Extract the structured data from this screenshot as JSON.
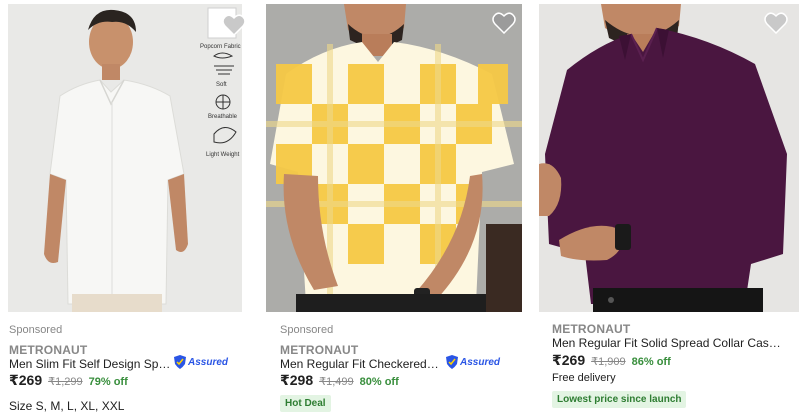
{
  "products": [
    {
      "sponsored": "Sponsored",
      "brand": "METRONAUT",
      "title": "Men Slim Fit Self Design Spre...",
      "assured": "Assured",
      "price": "₹269",
      "mrp": "₹1,299",
      "discount": "79% off",
      "sizes": "Size S, M, L, XL, XXL",
      "features": [
        "Popcorn Fabric",
        "Soft",
        "Breathable",
        "Light Weight"
      ],
      "shirt_color": "#f4f4f2"
    },
    {
      "sponsored": "Sponsored",
      "brand": "METRONAUT",
      "title": "Men Regular Fit Checkered S...",
      "assured": "Assured",
      "price": "₹298",
      "mrp": "₹1,499",
      "discount": "80% off",
      "tag": "Hot Deal",
      "shirt_color": "#f6c945"
    },
    {
      "brand": "METRONAUT",
      "title": "Men Regular Fit Solid Spread Collar Casual...",
      "price": "₹269",
      "mrp": "₹1,909",
      "discount": "86% off",
      "delivery": "Free delivery",
      "tag": "Lowest price since launch",
      "shirt_color": "#4a1640"
    }
  ],
  "colors": {
    "discount_green": "#388e3c",
    "assured_blue": "#2a55e5",
    "tag_bg": "#e3f4e3"
  }
}
